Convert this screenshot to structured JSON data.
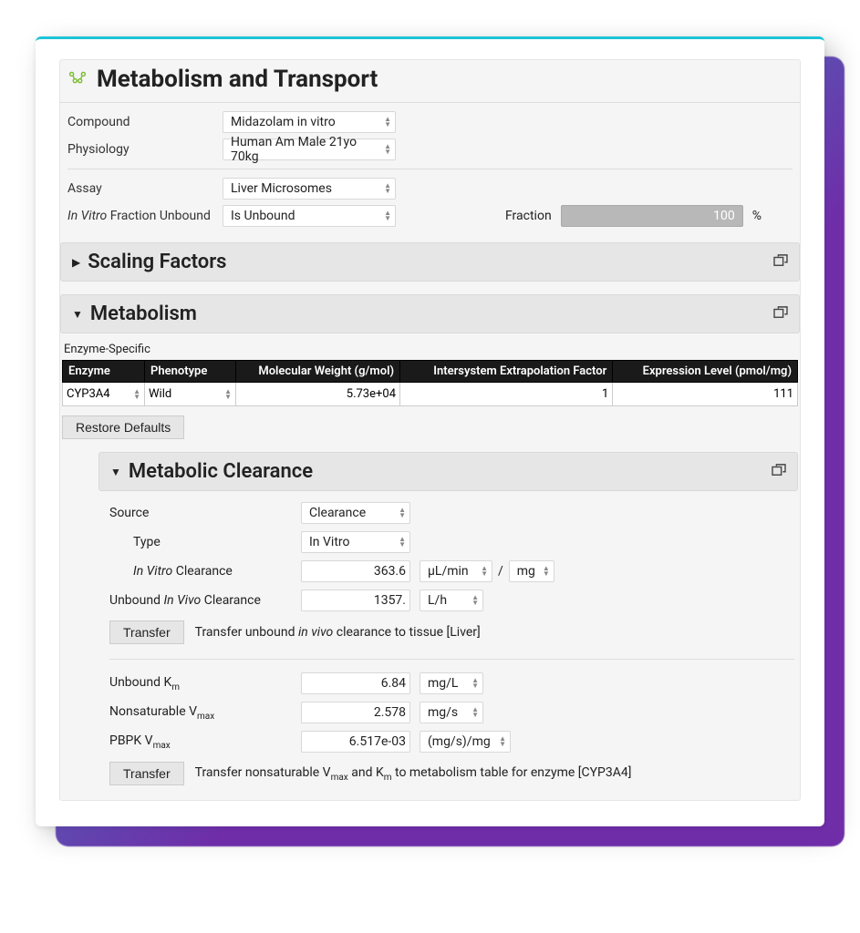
{
  "title": "Metabolism and Transport",
  "form": {
    "compound_label": "Compound",
    "compound_value": "Midazolam in vitro",
    "physiology_label": "Physiology",
    "physiology_value": "Human Am Male 21yo 70kg",
    "assay_label": "Assay",
    "assay_value": "Liver Microsomes",
    "ivfu_prefix": "In Vitro",
    "ivfu_suffix": " Fraction Unbound",
    "ivfu_value": "Is Unbound",
    "fraction_label": "Fraction",
    "fraction_value": "100",
    "fraction_unit": "%"
  },
  "accordions": {
    "scaling": "Scaling Factors",
    "metabolism": "Metabolism",
    "clearance": "Metabolic Clearance"
  },
  "enzyme": {
    "section_label": "Enzyme-Specific",
    "headers": {
      "enzyme": "Enzyme",
      "phenotype": "Phenotype",
      "mw": "Molecular Weight (g/mol)",
      "isef": "Intersystem Extrapolation Factor",
      "expr": "Expression Level (pmol/mg)"
    },
    "row": {
      "enzyme": "CYP3A4",
      "phenotype": "Wild",
      "mw": "5.73e+04",
      "isef": "1",
      "expr": "111"
    },
    "restore_btn": "Restore Defaults"
  },
  "clearance": {
    "source_label": "Source",
    "source_value": "Clearance",
    "type_label": "Type",
    "type_value": "In Vitro",
    "ivc_prefix": "In Vitro",
    "ivc_suffix": " Clearance",
    "ivc_value": "363.6",
    "ivc_unit1": "µL/min",
    "ivc_slash": "/",
    "ivc_unit2": "mg",
    "uivc_label_pre": "Unbound ",
    "uivc_label_it": "In Vivo",
    "uivc_label_post": " Clearance",
    "uivc_value": "1357.",
    "uivc_unit": "L/h",
    "transfer_btn": "Transfer",
    "transfer1_pre": "Transfer unbound ",
    "transfer1_it": "in vivo",
    "transfer1_post": " clearance to tissue [Liver]",
    "km_pre": "Unbound K",
    "km_sub": "m",
    "km_value": "6.84",
    "km_unit": "mg/L",
    "vmax_pre": "Nonsaturable V",
    "vmax_sub": "max",
    "vmax_value": "2.578",
    "vmax_unit": "mg/s",
    "pbpk_pre": "PBPK V",
    "pbpk_sub": "max",
    "pbpk_value": "6.517e-03",
    "pbpk_unit": "(mg/s)/mg",
    "transfer2_p1": "Transfer nonsaturable V",
    "transfer2_s1": "max",
    "transfer2_p2": " and K",
    "transfer2_s2": "m",
    "transfer2_p3": " to metabolism table for enzyme [CYP3A4]"
  }
}
